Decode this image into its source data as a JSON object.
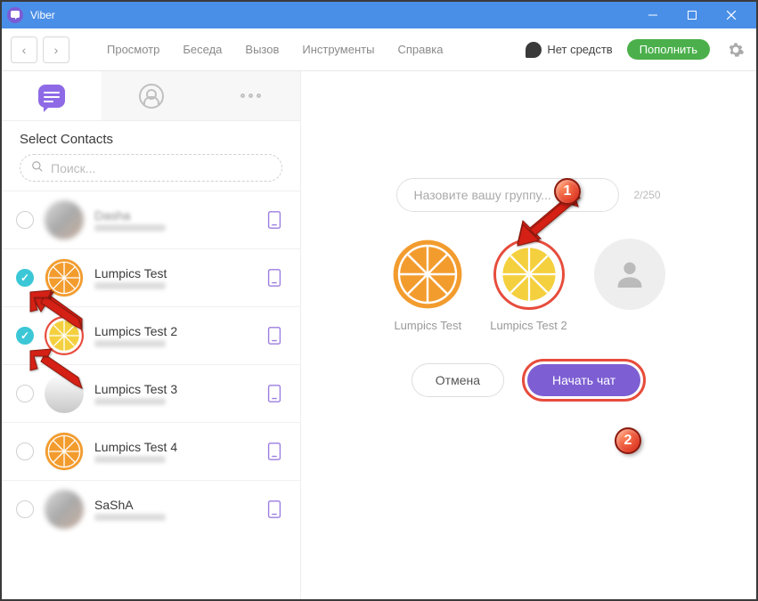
{
  "window": {
    "title": "Viber"
  },
  "toolbar": {
    "menu": [
      "Просмотр",
      "Беседа",
      "Вызов",
      "Инструменты",
      "Справка"
    ],
    "balance": "Нет средств",
    "topup": "Пополнить"
  },
  "sidebar": {
    "heading": "Select Contacts",
    "search_placeholder": "Поиск...",
    "contacts": [
      {
        "name": "Dasha",
        "selected": false,
        "avatar": "blurred",
        "obscured": true
      },
      {
        "name": "Lumpics Test",
        "selected": true,
        "avatar": "orange"
      },
      {
        "name": "Lumpics Test 2",
        "selected": true,
        "avatar": "yellow"
      },
      {
        "name": "Lumpics Test 3",
        "selected": false,
        "avatar": "gray"
      },
      {
        "name": "Lumpics Test 4",
        "selected": false,
        "avatar": "orange"
      },
      {
        "name": "SaShA",
        "selected": false,
        "avatar": "blurred"
      }
    ]
  },
  "main": {
    "group_name_placeholder": "Назовите вашу группу...",
    "char_count": "2/250",
    "participants": [
      {
        "name": "Lumpics Test",
        "avatar": "orange"
      },
      {
        "name": "Lumpics Test 2",
        "avatar": "yellow"
      }
    ],
    "cancel": "Отмена",
    "start_chat": "Начать чат"
  },
  "annotations": {
    "badge1": "1",
    "badge2": "2"
  }
}
